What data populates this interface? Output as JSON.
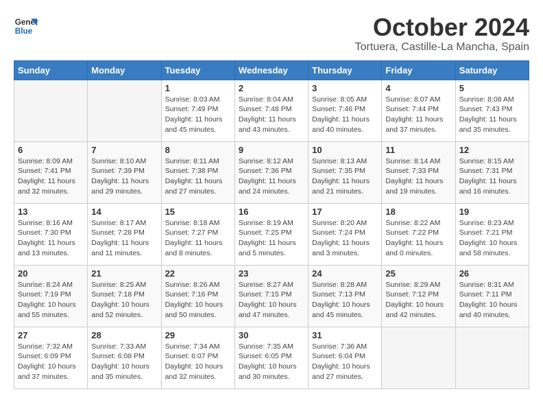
{
  "logo": {
    "line1": "General",
    "line2": "Blue"
  },
  "title": "October 2024",
  "location": "Tortuera, Castille-La Mancha, Spain",
  "days_header": [
    "Sunday",
    "Monday",
    "Tuesday",
    "Wednesday",
    "Thursday",
    "Friday",
    "Saturday"
  ],
  "weeks": [
    [
      {
        "day": "",
        "info": ""
      },
      {
        "day": "",
        "info": ""
      },
      {
        "day": "1",
        "info": "Sunrise: 8:03 AM\nSunset: 7:49 PM\nDaylight: 11 hours\nand 45 minutes."
      },
      {
        "day": "2",
        "info": "Sunrise: 8:04 AM\nSunset: 7:48 PM\nDaylight: 11 hours\nand 43 minutes."
      },
      {
        "day": "3",
        "info": "Sunrise: 8:05 AM\nSunset: 7:46 PM\nDaylight: 11 hours\nand 40 minutes."
      },
      {
        "day": "4",
        "info": "Sunrise: 8:07 AM\nSunset: 7:44 PM\nDaylight: 11 hours\nand 37 minutes."
      },
      {
        "day": "5",
        "info": "Sunrise: 8:08 AM\nSunset: 7:43 PM\nDaylight: 11 hours\nand 35 minutes."
      }
    ],
    [
      {
        "day": "6",
        "info": "Sunrise: 8:09 AM\nSunset: 7:41 PM\nDaylight: 11 hours\nand 32 minutes."
      },
      {
        "day": "7",
        "info": "Sunrise: 8:10 AM\nSunset: 7:39 PM\nDaylight: 11 hours\nand 29 minutes."
      },
      {
        "day": "8",
        "info": "Sunrise: 8:11 AM\nSunset: 7:38 PM\nDaylight: 11 hours\nand 27 minutes."
      },
      {
        "day": "9",
        "info": "Sunrise: 8:12 AM\nSunset: 7:36 PM\nDaylight: 11 hours\nand 24 minutes."
      },
      {
        "day": "10",
        "info": "Sunrise: 8:13 AM\nSunset: 7:35 PM\nDaylight: 11 hours\nand 21 minutes."
      },
      {
        "day": "11",
        "info": "Sunrise: 8:14 AM\nSunset: 7:33 PM\nDaylight: 11 hours\nand 19 minutes."
      },
      {
        "day": "12",
        "info": "Sunrise: 8:15 AM\nSunset: 7:31 PM\nDaylight: 11 hours\nand 16 minutes."
      }
    ],
    [
      {
        "day": "13",
        "info": "Sunrise: 8:16 AM\nSunset: 7:30 PM\nDaylight: 11 hours\nand 13 minutes."
      },
      {
        "day": "14",
        "info": "Sunrise: 8:17 AM\nSunset: 7:28 PM\nDaylight: 11 hours\nand 11 minutes."
      },
      {
        "day": "15",
        "info": "Sunrise: 8:18 AM\nSunset: 7:27 PM\nDaylight: 11 hours\nand 8 minutes."
      },
      {
        "day": "16",
        "info": "Sunrise: 8:19 AM\nSunset: 7:25 PM\nDaylight: 11 hours\nand 5 minutes."
      },
      {
        "day": "17",
        "info": "Sunrise: 8:20 AM\nSunset: 7:24 PM\nDaylight: 11 hours\nand 3 minutes."
      },
      {
        "day": "18",
        "info": "Sunrise: 8:22 AM\nSunset: 7:22 PM\nDaylight: 11 hours\nand 0 minutes."
      },
      {
        "day": "19",
        "info": "Sunrise: 8:23 AM\nSunset: 7:21 PM\nDaylight: 10 hours\nand 58 minutes."
      }
    ],
    [
      {
        "day": "20",
        "info": "Sunrise: 8:24 AM\nSunset: 7:19 PM\nDaylight: 10 hours\nand 55 minutes."
      },
      {
        "day": "21",
        "info": "Sunrise: 8:25 AM\nSunset: 7:18 PM\nDaylight: 10 hours\nand 52 minutes."
      },
      {
        "day": "22",
        "info": "Sunrise: 8:26 AM\nSunset: 7:16 PM\nDaylight: 10 hours\nand 50 minutes."
      },
      {
        "day": "23",
        "info": "Sunrise: 8:27 AM\nSunset: 7:15 PM\nDaylight: 10 hours\nand 47 minutes."
      },
      {
        "day": "24",
        "info": "Sunrise: 8:28 AM\nSunset: 7:13 PM\nDaylight: 10 hours\nand 45 minutes."
      },
      {
        "day": "25",
        "info": "Sunrise: 8:29 AM\nSunset: 7:12 PM\nDaylight: 10 hours\nand 42 minutes."
      },
      {
        "day": "26",
        "info": "Sunrise: 8:31 AM\nSunset: 7:11 PM\nDaylight: 10 hours\nand 40 minutes."
      }
    ],
    [
      {
        "day": "27",
        "info": "Sunrise: 7:32 AM\nSunset: 6:09 PM\nDaylight: 10 hours\nand 37 minutes."
      },
      {
        "day": "28",
        "info": "Sunrise: 7:33 AM\nSunset: 6:08 PM\nDaylight: 10 hours\nand 35 minutes."
      },
      {
        "day": "29",
        "info": "Sunrise: 7:34 AM\nSunset: 6:07 PM\nDaylight: 10 hours\nand 32 minutes."
      },
      {
        "day": "30",
        "info": "Sunrise: 7:35 AM\nSunset: 6:05 PM\nDaylight: 10 hours\nand 30 minutes."
      },
      {
        "day": "31",
        "info": "Sunrise: 7:36 AM\nSunset: 6:04 PM\nDaylight: 10 hours\nand 27 minutes."
      },
      {
        "day": "",
        "info": ""
      },
      {
        "day": "",
        "info": ""
      }
    ]
  ]
}
